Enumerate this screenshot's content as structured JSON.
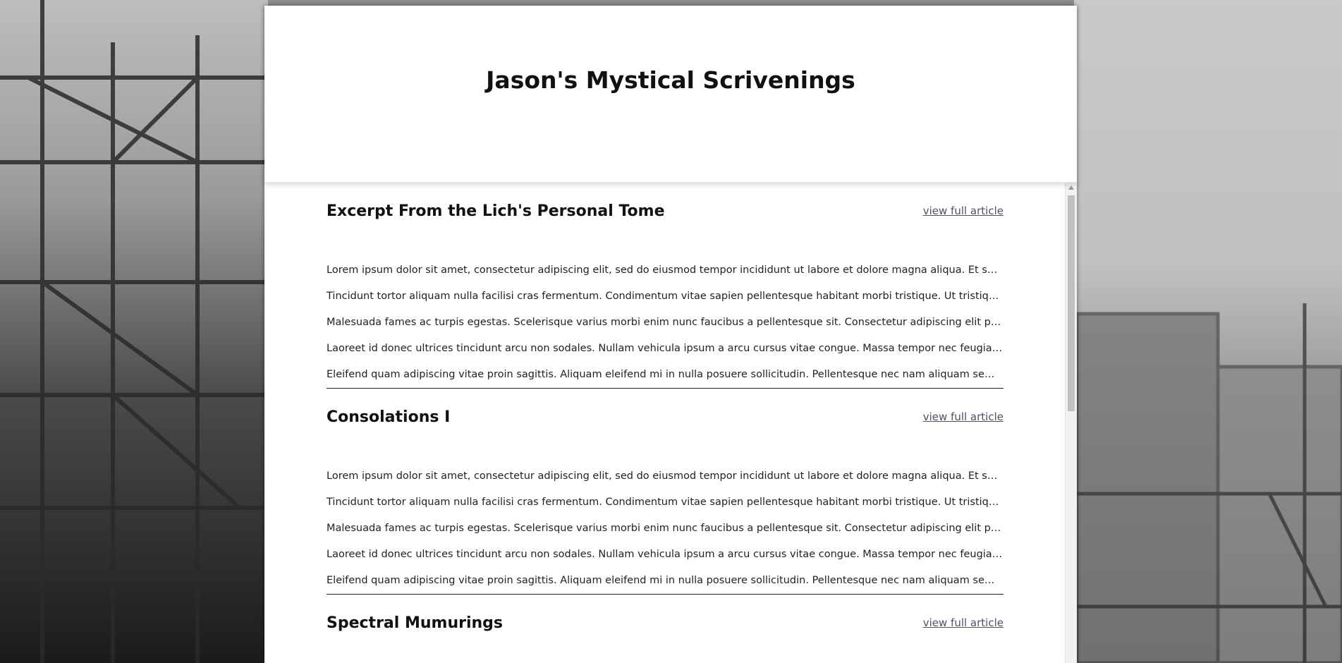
{
  "site": {
    "title": "Jason's Mystical Scrivenings"
  },
  "articles": [
    {
      "title": "Excerpt From the Lich's Personal Tome",
      "link_label": "view full article",
      "lines": [
        "Lorem ipsum dolor sit amet, consectetur adipiscing elit, sed do eiusmod tempor incididunt ut labore et dolore magna aliqua. Et sollicitudin ac orci phasellus egestas tellus rutrum tellus.",
        "Tincidunt tortor aliquam nulla facilisi cras fermentum. Condimentum vitae sapien pellentesque habitant morbi tristique. Ut tristique et egestas quis ipsum suspendisse ultrices.",
        "Malesuada fames ac turpis egestas. Scelerisque varius morbi enim nunc faucibus a pellentesque sit. Consectetur adipiscing elit pellentesque habitant morbi tristique senectus.",
        "Laoreet id donec ultrices tincidunt arcu non sodales. Nullam vehicula ipsum a arcu cursus vitae congue. Massa tempor nec feugiat nisl pretium fusce id velit ut tortor.",
        "Eleifend quam adipiscing vitae proin sagittis. Aliquam eleifend mi in nulla posuere sollicitudin. Pellentesque nec nam aliquam sem et tortor consequat id porta nibh."
      ]
    },
    {
      "title": "Consolations I",
      "link_label": "view full article",
      "lines": [
        "Lorem ipsum dolor sit amet, consectetur adipiscing elit, sed do eiusmod tempor incididunt ut labore et dolore magna aliqua. Et sollicitudin ac orci phasellus egestas tellus rutrum tellus.",
        "Tincidunt tortor aliquam nulla facilisi cras fermentum. Condimentum vitae sapien pellentesque habitant morbi tristique. Ut tristique et egestas quis ipsum suspendisse ultrices.",
        "Malesuada fames ac turpis egestas. Scelerisque varius morbi enim nunc faucibus a pellentesque sit. Consectetur adipiscing elit pellentesque habitant morbi tristique senectus.",
        "Laoreet id donec ultrices tincidunt arcu non sodales. Nullam vehicula ipsum a arcu cursus vitae congue. Massa tempor nec feugiat nisl pretium fusce id velit ut tortor.",
        "Eleifend quam adipiscing vitae proin sagittis. Aliquam eleifend mi in nulla posuere sollicitudin. Pellentesque nec nam aliquam sem et tortor consequat id porta nibh."
      ]
    },
    {
      "title": "Spectral Mumurings",
      "link_label": "view full article",
      "lines": []
    }
  ]
}
